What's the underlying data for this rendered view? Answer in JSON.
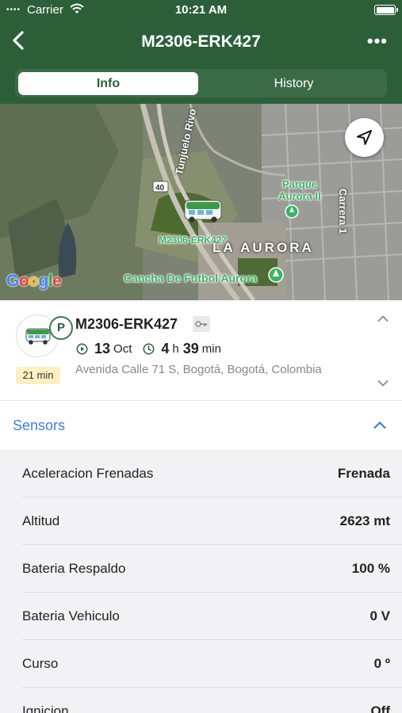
{
  "status_bar": {
    "carrier": "Carrier",
    "time": "10:21 AM"
  },
  "nav": {
    "title": "M2306-ERK427",
    "more": "•••"
  },
  "tabs": [
    {
      "label": "Info",
      "active": true
    },
    {
      "label": "History",
      "active": false
    }
  ],
  "map": {
    "labels": {
      "river": "Tunjuelo Rivo",
      "route": "40",
      "park": "Parque Aurora II",
      "street": "Carrera 1",
      "neighborhood": "LA AURORA",
      "vehicle": "M2306-ERK427",
      "field": "Cancha De Futbol Aurora"
    },
    "google": "Google"
  },
  "vehicle": {
    "plate": "M2306-ERK427",
    "status_letter": "P",
    "duration": "21 min",
    "date_day": "13",
    "date_month": "Oct",
    "time_hours": "4",
    "time_h_unit": "h",
    "time_minutes": "39",
    "time_min_unit": "min",
    "address": "Avenida Calle 71 S, Bogotá, Bogotá, Colombia"
  },
  "sensors": {
    "title": "Sensors",
    "rows": [
      {
        "name": "Aceleracion Frenadas",
        "value": "Frenada"
      },
      {
        "name": "Altitud",
        "value": "2623 mt"
      },
      {
        "name": "Bateria Respaldo",
        "value": "100 %"
      },
      {
        "name": "Bateria Vehiculo",
        "value": "0 V"
      },
      {
        "name": "Curso",
        "value": "0 º"
      },
      {
        "name": "Ignicion",
        "value": "Off"
      }
    ]
  },
  "colors": {
    "header": "#2c5f38",
    "accent": "#3d7fe0",
    "map_label": "#3cb465",
    "duration_badge": "#fdf0c0"
  },
  "icons": [
    "wifi-icon",
    "battery-icon",
    "back-chevron-icon",
    "more-icon",
    "navigation-arrow-icon",
    "bus-icon",
    "key-icon",
    "play-circle-icon",
    "clock-icon",
    "chevron-up-icon",
    "chevron-down-icon",
    "map-pin-icon"
  ]
}
